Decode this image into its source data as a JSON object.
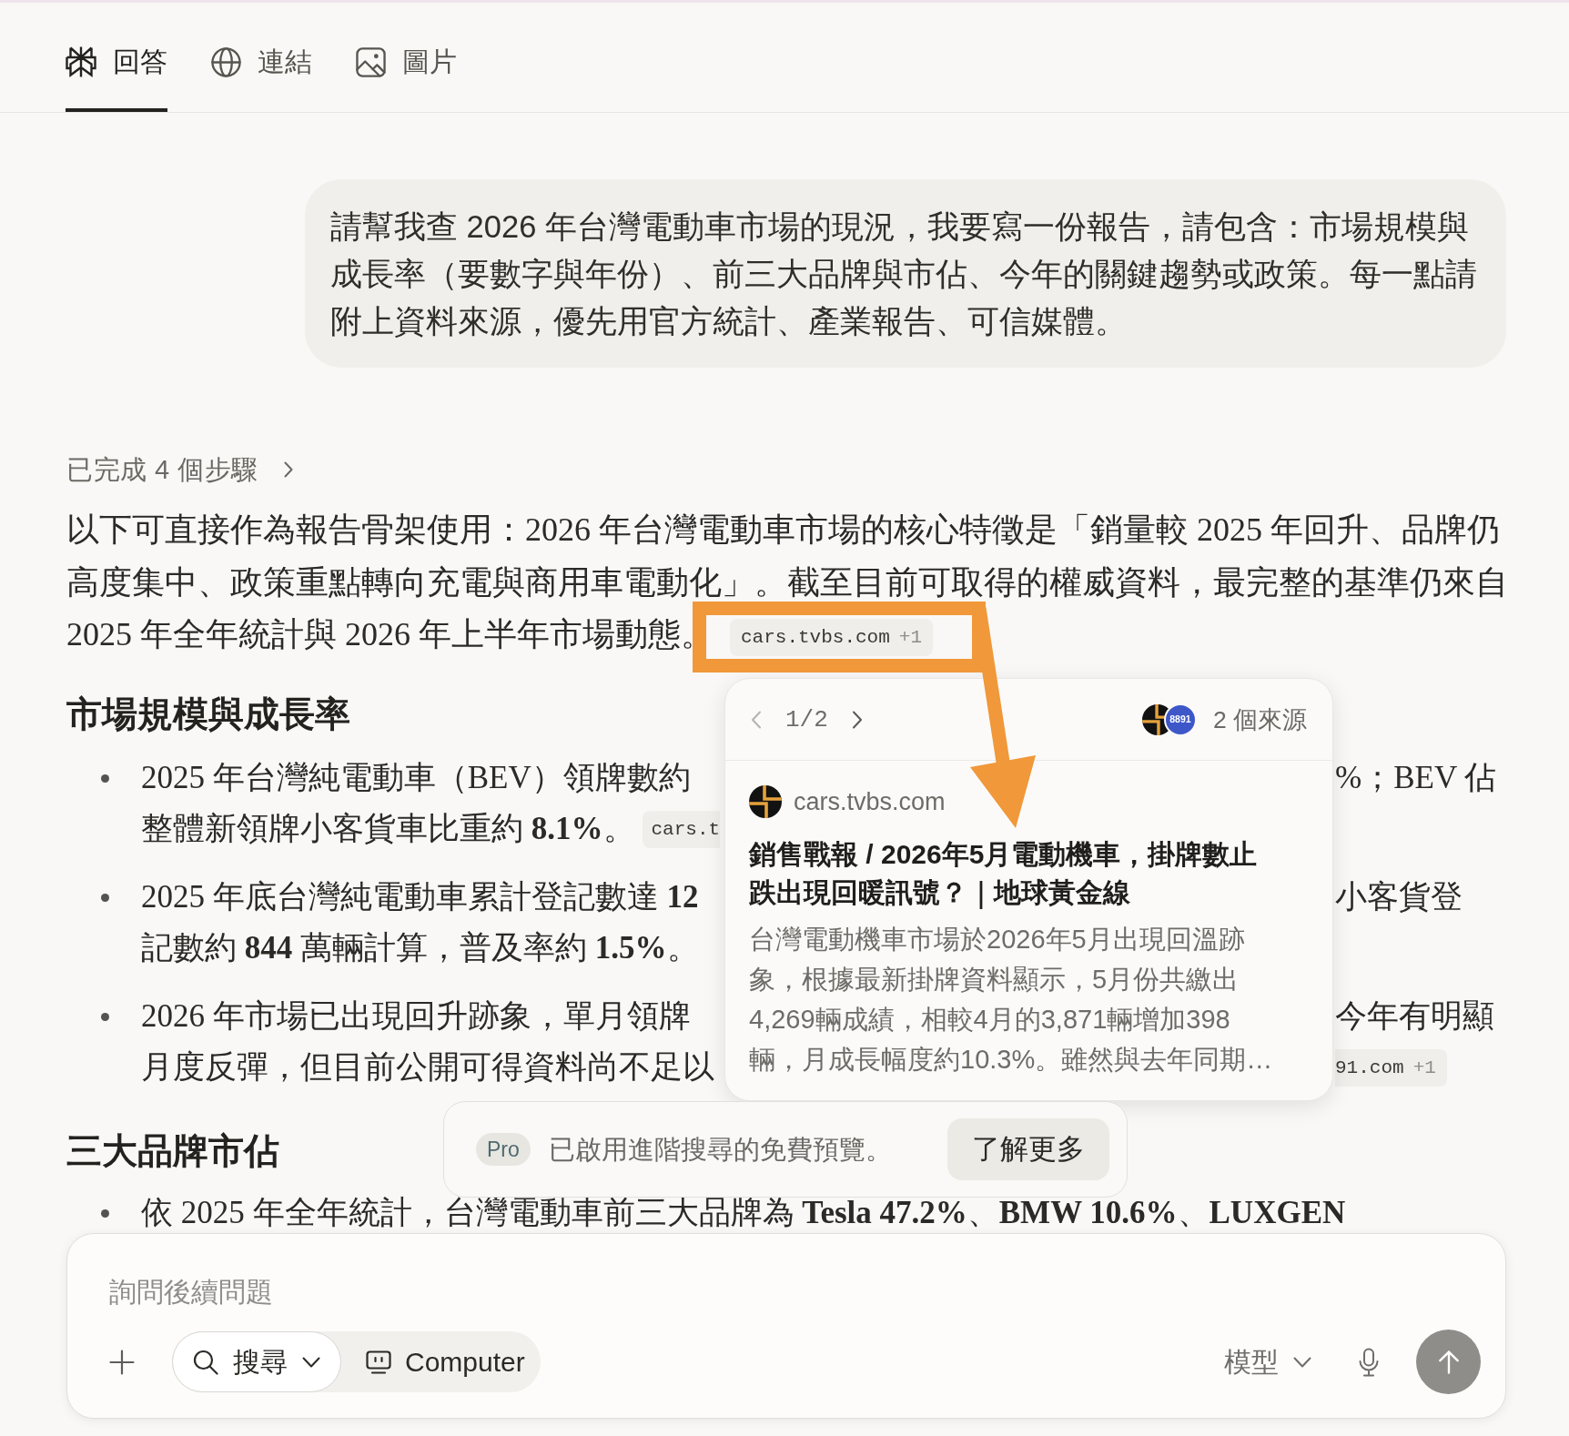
{
  "tabs": [
    {
      "label": "回答",
      "selected": true
    },
    {
      "label": "連結",
      "selected": false
    },
    {
      "label": "圖片",
      "selected": false
    }
  ],
  "thread": {
    "user_message": "請幫我查 2026 年台灣電動車市場的現況，我要寫一份報告，請包含：市場規模與成長率（要數字與年份）、前三大品牌與市佔、今年的關鍵趨勢或政策。每一點請附上資料來源，優先用官方統計、產業報告、可信媒體。",
    "steps_label": "已完成 4 個步驟"
  },
  "answer": {
    "intro": "以下可直接作為報告骨架使用：2026 年台灣電動車市場的核心特徵是「銷量較 2025 年回升、品牌仍高度集中、政策重點轉向充電與商用車電動化」。截至目前可取得的權威資料，最完整的基準仍來自 2025 年全年統計與 2026 年上半年市場動態。",
    "intro_citation": {
      "source": "cars.tvbs.com",
      "count": "+1"
    },
    "sections": [
      {
        "heading": "市場規模與成長率",
        "bullets": [
          {
            "lines": [
              {
                "left": [
                  {
                    "kind": "text",
                    "text": "2025 年台灣純電動車（BEV）領牌數約"
                  }
                ],
                "right": [
                  {
                    "kind": "text",
                    "text": "%；BEV 佔"
                  }
                ]
              },
              {
                "left": [
                  {
                    "kind": "text",
                    "text": "整體新領牌小客貨車比重約 **8.1%**。"
                  },
                  {
                    "kind": "citation",
                    "source": "cars.t"
                  }
                ]
              }
            ]
          },
          {
            "lines": [
              {
                "left": [
                  {
                    "kind": "text",
                    "text": "2025 年底台灣純電動車累計登記數達 **12**"
                  }
                ],
                "right": [
                  {
                    "kind": "text",
                    "text": "小客貨登"
                  }
                ]
              },
              {
                "left": [
                  {
                    "kind": "text",
                    "text": "記數約 **844** 萬輛計算，普及率約 **1.5%**。"
                  }
                ]
              }
            ]
          },
          {
            "lines": [
              {
                "left": [
                  {
                    "kind": "text",
                    "text": "2026 年市場已出現回升跡象，單月領牌"
                  }
                ],
                "right": [
                  {
                    "kind": "text",
                    "text": "今年有明顯"
                  }
                ]
              },
              {
                "left": [
                  {
                    "kind": "text",
                    "text": "月度反彈，但目前公開可得資料尚不足以"
                  }
                ],
                "right": [
                  {
                    "kind": "citation",
                    "source": "91.com",
                    "count": "+1"
                  }
                ]
              }
            ]
          }
        ]
      },
      {
        "heading": "三大品牌市佔",
        "bullets": [
          {
            "lines": [
              {
                "left": [
                  {
                    "kind": "text",
                    "text": "依 2025 年全年統計，台灣電動車前三大品牌為 **Tesla 47.2%**、**BMW 10.6%**、**LUXGEN**"
                  }
                ]
              }
            ]
          }
        ]
      }
    ]
  },
  "source_popover": {
    "pager": {
      "position": "1/2",
      "prev_disabled": true,
      "next_disabled": false
    },
    "logos": [
      {
        "kind": "mark"
      },
      {
        "kind": "badge",
        "text": "8891"
      }
    ],
    "source_count": "2 個來源",
    "domain": "cars.tvbs.com",
    "title": "銷售戰報 / 2026年5月電動機車，掛牌數止跌出現回暖訊號？｜地球黃金線",
    "snippet": "台灣電動機車市場於2026年5月出現回溫跡象，根據最新掛牌資料顯示，5月份共繳出4,269輛成績，相較4月的3,871輛增加398輛，月成長幅度約10.3%。雖然與去年同期…"
  },
  "pro_banner": {
    "badge": "Pro",
    "message": "已啟用進階搜尋的免費預覽。",
    "button": "了解更多"
  },
  "composer": {
    "placeholder": "詢問後續問題",
    "modes": [
      {
        "kind": "search",
        "label": "搜尋",
        "selected": true,
        "menu": true
      },
      {
        "kind": "computer",
        "label": "Computer",
        "selected": false,
        "menu": false
      }
    ],
    "model_button": "模型"
  }
}
